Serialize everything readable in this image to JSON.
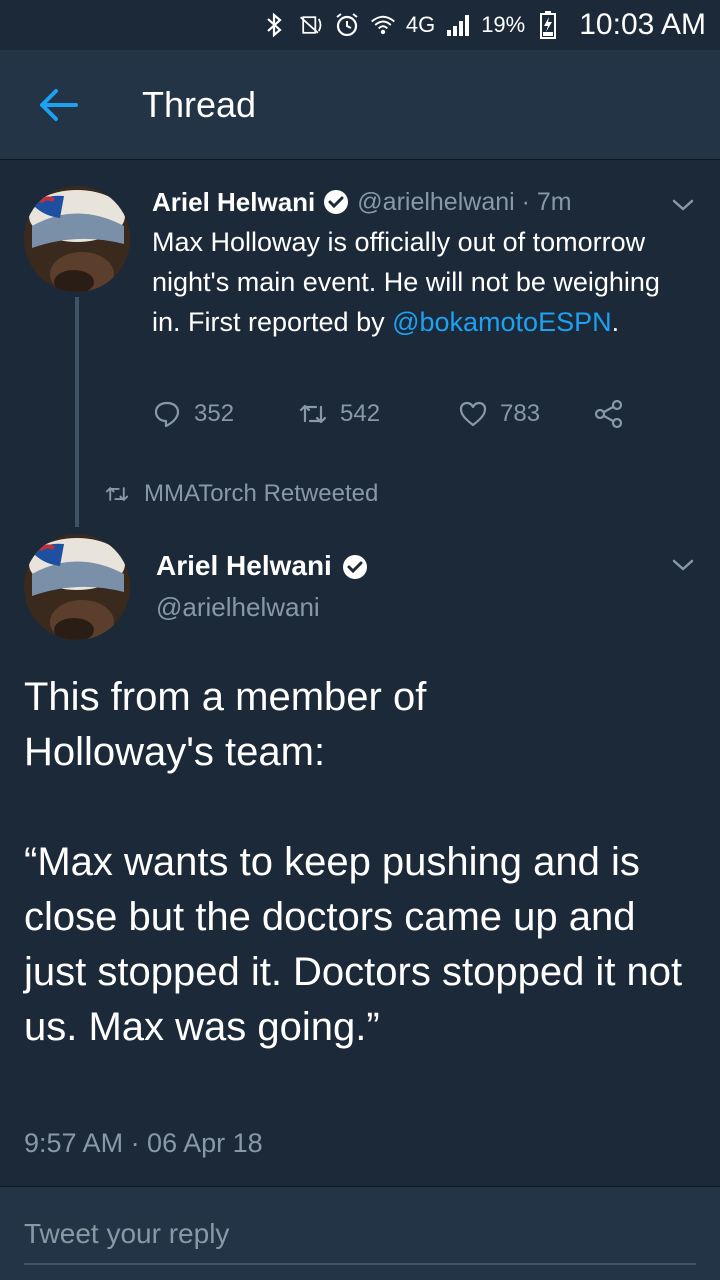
{
  "status_bar": {
    "battery": "19%",
    "time": "10:03 AM",
    "network": "4G"
  },
  "app_bar": {
    "title": "Thread"
  },
  "tweet1": {
    "name": "Ariel Helwani",
    "handle_time": "@arielhelwani · 7m",
    "text_before": "Max Holloway is officially out of tomorrow night's main event. He will not be weighing in. First reported by ",
    "mention": "@bokamotoESPN",
    "text_after": ".",
    "replies": "352",
    "retweets": "542",
    "likes": "783"
  },
  "retweet_context": {
    "label": "MMATorch Retweeted"
  },
  "tweet2": {
    "name": "Ariel Helwani",
    "handle": "@arielhelwani",
    "text": "This from a member of\nHolloway's team:\n\n“Max wants to keep pushing and is close but the doctors came up and just stopped it. Doctors stopped it not us. Max was going.”",
    "timestamp": "9:57 AM · 06 Apr 18"
  },
  "reply": {
    "placeholder": "Tweet your reply"
  },
  "colors": {
    "background": "#1c2938",
    "app_bar": "#243447",
    "accent": "#1da1f2",
    "secondary_text": "#8899a6"
  }
}
